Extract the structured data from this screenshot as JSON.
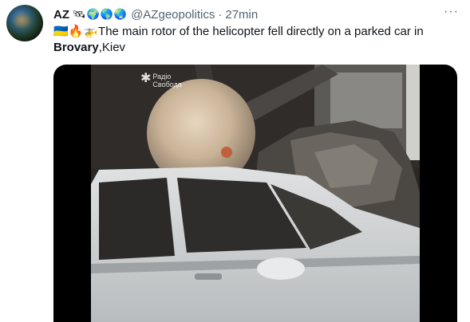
{
  "tweet": {
    "author": {
      "display_name": "AZ",
      "name_emoji": "🛰🌍🌎🌏",
      "handle": "@AZgeopolitics",
      "separator": "·",
      "time": "27min"
    },
    "more_icon": "···",
    "text": {
      "prefix_emoji": "🇺🇦🔥🚁",
      "body": "The main rotor of the helicopter fell directly on a parked car in ",
      "city": "Brovary",
      "suffix": ",Kiev"
    },
    "media": {
      "watermark_line1": "Радіо",
      "watermark_line2": "Свобода"
    }
  }
}
